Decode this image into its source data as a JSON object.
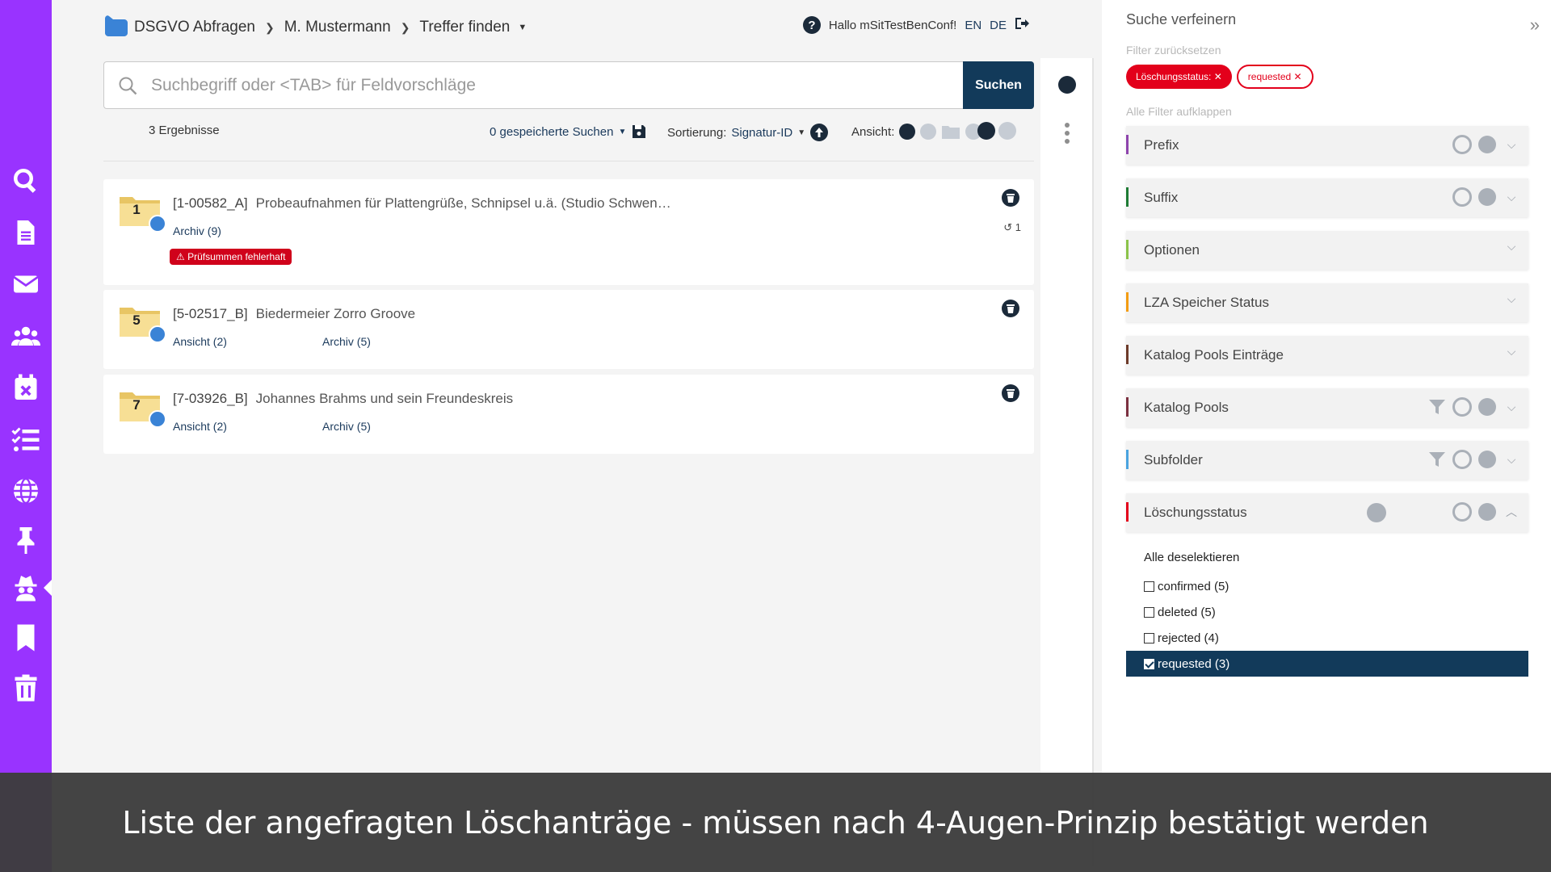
{
  "breadcrumb": {
    "items": [
      "DSGVO Abfragen",
      "M. Mustermann",
      "Treffer finden"
    ]
  },
  "user": {
    "greeting": "Hallo mSitTestBenConf!",
    "lang_en": "EN",
    "lang_de": "DE"
  },
  "search": {
    "placeholder": "Suchbegriff oder <TAB> für Feldvorschläge",
    "button": "Suchen"
  },
  "toolbar": {
    "results": "3 Ergebnisse",
    "saved_searches": "0 gespeicherte Suchen",
    "sort_label": "Sortierung:",
    "sort_value": "Signatur-ID",
    "view_label": "Ansicht:"
  },
  "results": [
    {
      "number": "1",
      "signature": "[1-00582_A]",
      "title": "Probeaufnahmen für Plattengrüße, Schnipsel u.ä. (Studio Schwen…",
      "links": [
        "Archiv (9)"
      ],
      "error": "Prüfsummen fehlerhaft",
      "history": "1"
    },
    {
      "number": "5",
      "signature": "[5-02517_B]",
      "title": "Biedermeier Zorro Groove",
      "links": [
        "Ansicht (2)",
        "Archiv (5)"
      ]
    },
    {
      "number": "7",
      "signature": "[7-03926_B]",
      "title": "Johannes Brahms und sein Freundeskreis",
      "links": [
        "Ansicht (2)",
        "Archiv (5)"
      ]
    }
  ],
  "filter_panel": {
    "title": "Suche verfeinern",
    "reset": "Filter zurücksetzen",
    "chip_label": "Löschungsstatus:",
    "chip_value": "requested",
    "expand_all": "Alle Filter aufklappen",
    "facets": [
      {
        "label": "Prefix",
        "color": "#8e44ad"
      },
      {
        "label": "Suffix",
        "color": "#1e7b34"
      },
      {
        "label": "Optionen",
        "color": "#8bc34a"
      },
      {
        "label": "LZA Speicher Status",
        "color": "#f39c12"
      },
      {
        "label": "Katalog Pools Einträge",
        "color": "#6d3b2a"
      },
      {
        "label": "Katalog Pools",
        "color": "#7b3040"
      },
      {
        "label": "Subfolder",
        "color": "#4aa3df"
      },
      {
        "label": "Löschungsstatus",
        "color": "#e3001b"
      }
    ],
    "deselect_all": "Alle deselektieren",
    "options": [
      {
        "label": "confirmed (5)",
        "checked": false
      },
      {
        "label": "deleted (5)",
        "checked": false
      },
      {
        "label": "rejected (4)",
        "checked": false
      },
      {
        "label": "requested (3)",
        "checked": true
      }
    ]
  },
  "caption": "Liste der angefragten Löschanträge - müssen nach 4-Augen-Prinzip bestätigt werden",
  "colors": {
    "sidebar": "#9933ff",
    "primary": "#123a5a",
    "danger": "#e3001b"
  }
}
